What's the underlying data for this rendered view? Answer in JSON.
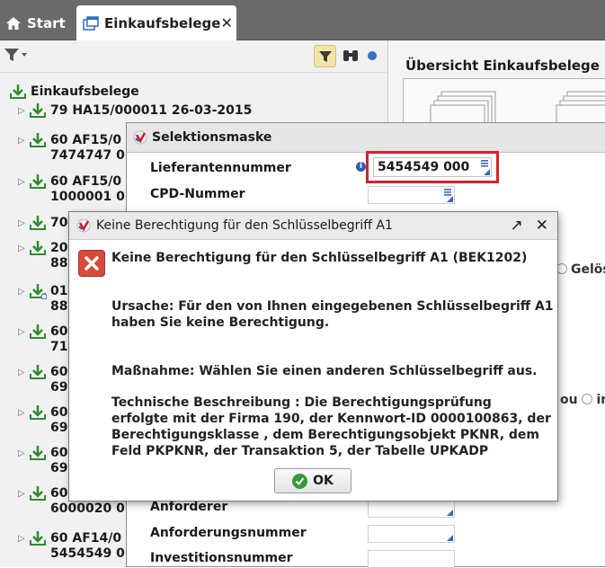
{
  "tabs": [
    {
      "label": "Start",
      "icon": "home-icon"
    },
    {
      "label": "Einkaufsbelege",
      "icon": "window-icon",
      "active": true
    }
  ],
  "tree": {
    "root_label": "Einkaufsbelege",
    "nodes": [
      {
        "line1": "79 HA15/000011 26-03-2015",
        "line2": ""
      },
      {
        "line1": "60 AF15/0",
        "line2": "7474747 0"
      },
      {
        "line1": "60 AF15/0",
        "line2": "1000001 0"
      },
      {
        "line1": "70",
        "line2": ""
      },
      {
        "line1": "20",
        "line2": "88"
      },
      {
        "line1": "01",
        "line2": "88"
      },
      {
        "line1": "60",
        "line2": "71"
      },
      {
        "line1": "60",
        "line2": "69"
      },
      {
        "line1": "60",
        "line2": "69"
      },
      {
        "line1": "60",
        "line2": "69"
      },
      {
        "line1": "60",
        "line2": "6000020 0"
      },
      {
        "line1": "60 AF14/0",
        "line2": "5454549 0"
      }
    ]
  },
  "right_panel": {
    "title": "Übersicht Einkaufsbelege",
    "radio_a": "Gelös",
    "radio_b_prefix": "ou",
    "radio_b": "in"
  },
  "selection_mask": {
    "title": "Selektionsmaske",
    "fields": {
      "lieferant_label": "Lieferantennummer",
      "lieferant_value": "5454549 000",
      "cpd_label": "CPD-Nummer",
      "anforderer_label": "Anforderer",
      "anforderungsnummer_label": "Anforderungsnummer",
      "investitionsnummer_label": "Investitionsnummer"
    }
  },
  "error_dialog": {
    "title": "Keine Berechtigung für den Schlüsselbegriff A1",
    "heading": "Keine Berechtigung für den Schlüsselbegriff A1 (BEK1202)",
    "cause_line1": "Ursache: Für den von Ihnen eingegebenen Schlüsselbegriff A1",
    "cause_line2": "haben Sie keine Berechtigung.",
    "measure": "Maßnahme: Wählen Sie einen anderen Schlüsselbegriff aus.",
    "tech_line1": "Technische Beschreibung : Die Berechtigungsprüfung",
    "tech_line2": "erfolgte mit der Firma 190, der Kennwort-ID 0000100863, der",
    "tech_line3": "Berechtigungsklasse , dem Berechtigungsobjekt PKNR, dem",
    "tech_line4": "Feld PKPKNR, der Transaktion 5, der Tabelle UPKADP",
    "ok_label": "OK"
  },
  "colors": {
    "accent": "#2f6bc2",
    "error_red": "#d8222a",
    "tab_bar": "#6a6a6a",
    "tree_icon_green": "#2e8b2e"
  }
}
